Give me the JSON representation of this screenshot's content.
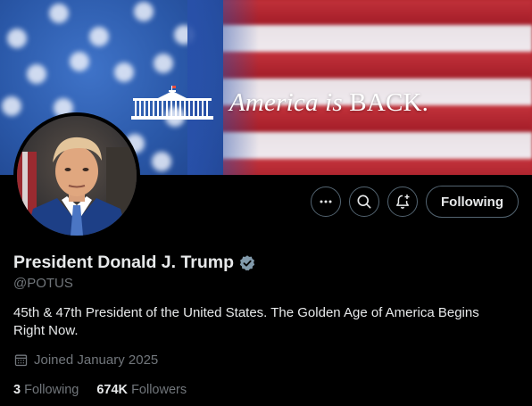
{
  "banner": {
    "text_italic": "America is ",
    "text_caps": "BACK."
  },
  "profile": {
    "display_name": "President Donald J. Trump",
    "handle": "@POTUS",
    "bio": "45th & 47th President of the United States. The Golden Age of America Begins Right Now.",
    "joined": "Joined January 2025",
    "verified": true
  },
  "actions": {
    "more_icon": "more-icon",
    "search_icon": "search-icon",
    "notify_icon": "notify-icon",
    "follow_label": "Following"
  },
  "stats": {
    "following_count": "3",
    "following_label": "Following",
    "followers_count": "674K",
    "followers_label": "Followers"
  },
  "colors": {
    "background": "#000000",
    "text_primary": "#e7e9ea",
    "text_secondary": "#71767b",
    "border": "#536471",
    "verified_badge": "#829aab"
  }
}
